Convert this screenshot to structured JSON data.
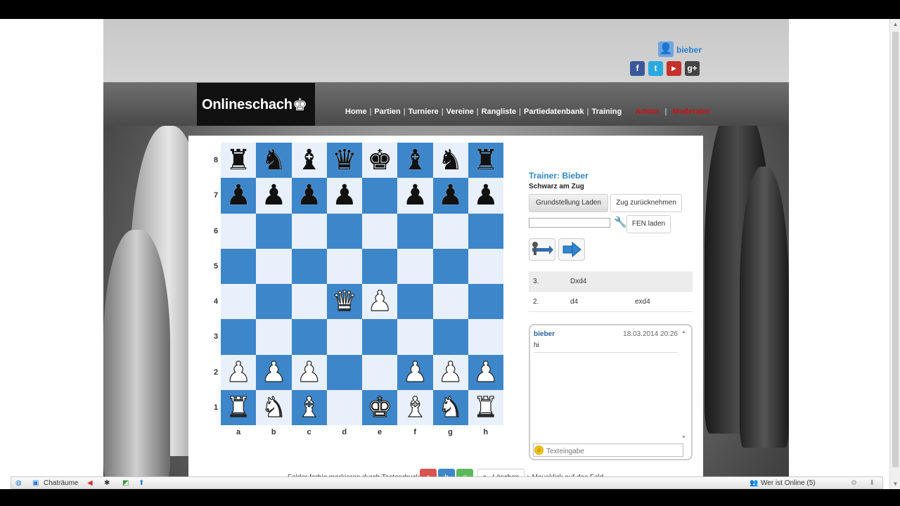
{
  "header": {
    "user": "bieber",
    "logo_text": "Onlineschach"
  },
  "social": [
    {
      "name": "facebook",
      "glyph": "f",
      "color": "#3b5998"
    },
    {
      "name": "twitter",
      "glyph": "t",
      "color": "#2aa9e0"
    },
    {
      "name": "youtube",
      "glyph": "▶",
      "color": "#c4302b"
    },
    {
      "name": "googleplus",
      "glyph": "g+",
      "color": "#444444"
    }
  ],
  "nav": [
    "Home",
    "Partien",
    "Turniere",
    "Vereine",
    "Rangliste",
    "Partiedatenbank",
    "Training"
  ],
  "nav_extra": [
    "Admin",
    "Moderator"
  ],
  "board": {
    "files": [
      "a",
      "b",
      "c",
      "d",
      "e",
      "f",
      "g",
      "h"
    ],
    "ranks": [
      "8",
      "7",
      "6",
      "5",
      "4",
      "3",
      "2",
      "1"
    ],
    "position": [
      [
        "r",
        "n",
        "b",
        "q",
        "k",
        "b",
        "n",
        "r"
      ],
      [
        "p",
        "p",
        "p",
        "p",
        "",
        "p",
        "p",
        "p"
      ],
      [
        "",
        "",
        "",
        "",
        "",
        "",
        "",
        ""
      ],
      [
        "",
        "",
        "",
        "",
        "",
        "",
        "",
        ""
      ],
      [
        "",
        "",
        "",
        "Q",
        "P",
        "",
        "",
        ""
      ],
      [
        "",
        "",
        "",
        "",
        "",
        "",
        "",
        ""
      ],
      [
        "P",
        "P",
        "P",
        "",
        "",
        "P",
        "P",
        "P"
      ],
      [
        "R",
        "N",
        "B",
        "",
        "K",
        "B",
        "N",
        "R"
      ]
    ]
  },
  "panel": {
    "trainer": "Trainer: Bieber",
    "turn": "Schwarz am Zug",
    "reset_button": "Grundstellung Laden",
    "undo_button": "Zug zurücknehmen",
    "fen_button": "FEN laden",
    "fen_value": ""
  },
  "moves": [
    {
      "num": "3.",
      "white": "Dxd4",
      "black": ""
    },
    {
      "num": "2.",
      "white": "d4",
      "black": "exd4"
    }
  ],
  "chat": {
    "user": "bieber",
    "time": "18.03.2014 20:26",
    "message": "hi",
    "placeholder": "Texteingabe"
  },
  "marking": {
    "label": "Felder farbig markieren durch Tastendruck:",
    "red": "r",
    "blue": "b",
    "green": "g",
    "clear": "c - Löschen",
    "mouse": "+ Mausklick auf das Feld"
  },
  "bottombar": {
    "chatrooms": "Chaträume",
    "online": "Wer ist Online (5)"
  }
}
